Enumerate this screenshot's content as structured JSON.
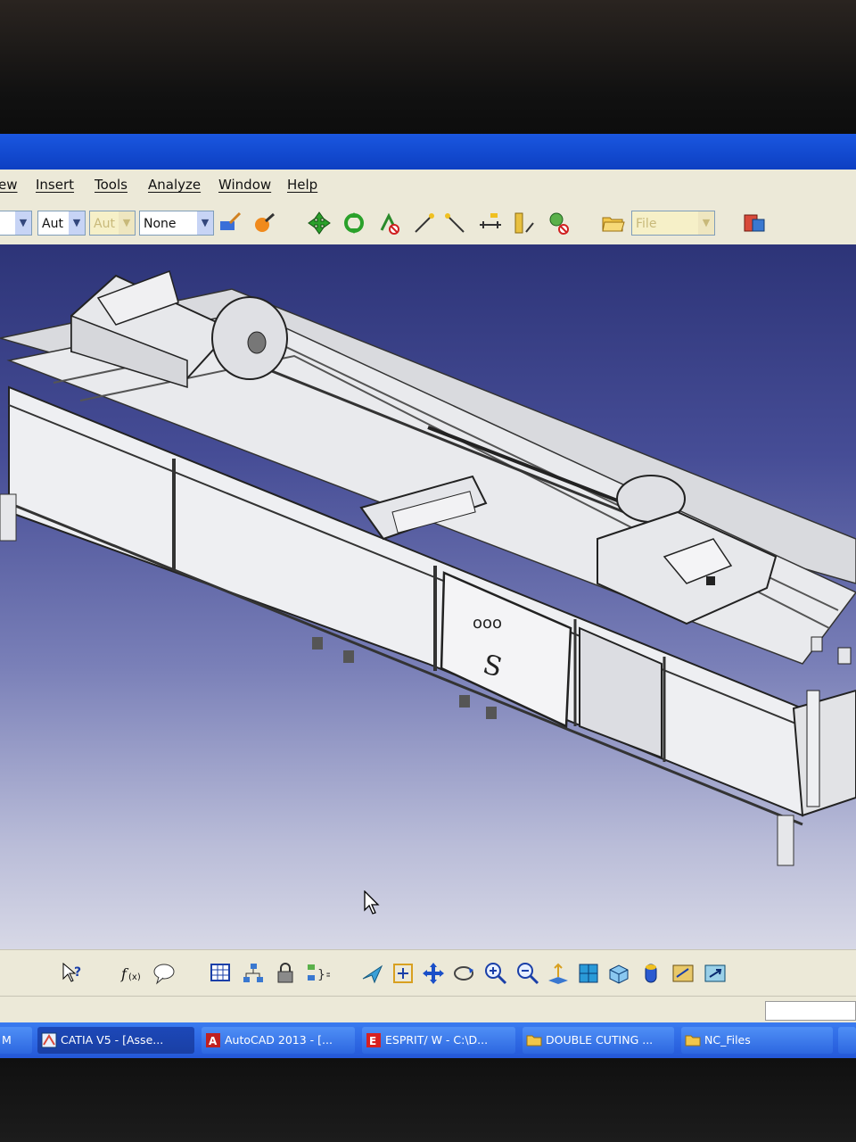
{
  "menu": {
    "view_partial": "ew",
    "insert": "Insert",
    "tools": "Tools",
    "analyze": "Analyze",
    "window": "Window",
    "help": "Help"
  },
  "toolbar": {
    "combo_1": "Aut",
    "combo_2": "Aut",
    "combo_3": "None",
    "file_combo": "File"
  },
  "model": {
    "door_label_dots": "ooo",
    "door_label_letter": "S"
  },
  "taskbar": {
    "items": [
      {
        "label": "M"
      },
      {
        "label": "CATIA V5 - [Asse..."
      },
      {
        "label": "AutoCAD 2013 - [..."
      },
      {
        "label": "ESPRIT/ W  - C:\\D..."
      },
      {
        "label": "DOUBLE CUTING ..."
      },
      {
        "label": "NC_Files"
      }
    ]
  },
  "colors": {
    "title_bar": "#0d3fc2",
    "menu_bg": "#ece9d8",
    "viewport_top": "#2d3478",
    "viewport_bottom": "#d7d8e6",
    "taskbar": "#2458d8"
  }
}
